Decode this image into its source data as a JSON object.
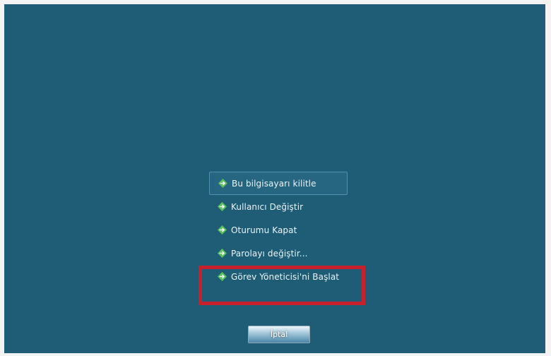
{
  "menu": {
    "items": [
      {
        "label": "Bu bilgisayarı kilitle",
        "icon": "arrow-right-icon"
      },
      {
        "label": "Kullanıcı Değiştir",
        "icon": "arrow-right-icon"
      },
      {
        "label": "Oturumu Kapat",
        "icon": "arrow-right-icon"
      },
      {
        "label": "Parolayı değiştir...",
        "icon": "arrow-right-icon"
      },
      {
        "label": "Görev Yöneticisi'ni Başlat",
        "icon": "arrow-right-icon"
      }
    ]
  },
  "cancel_button": {
    "label": "İptal"
  },
  "colors": {
    "background": "#1f5d77",
    "highlight": "#c8202c",
    "icon_green": "#57c15c"
  }
}
